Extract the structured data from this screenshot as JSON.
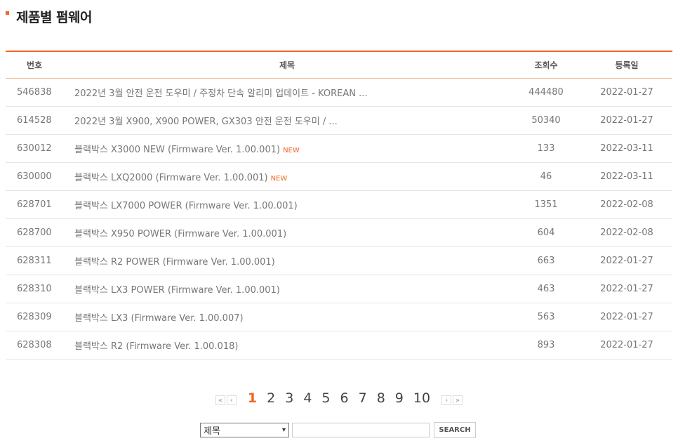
{
  "page": {
    "title": "제품별 펌웨어"
  },
  "table": {
    "headers": {
      "num": "번호",
      "title": "제목",
      "views": "조회수",
      "date": "등록일"
    },
    "new_label": "NEW",
    "rows": [
      {
        "num": "546838",
        "title": "2022년 3월 안전 운전 도우미 / 주정차 단속 알리미 업데이트 - KOREAN ...",
        "is_new": false,
        "views": "444480",
        "date": "2022-01-27"
      },
      {
        "num": "614528",
        "title": "2022년 3월 X900, X900 POWER, GX303 안전 운전 도우미 / ...",
        "is_new": false,
        "views": "50340",
        "date": "2022-01-27"
      },
      {
        "num": "630012",
        "title": "블랙박스 X3000 NEW (Firmware Ver. 1.00.001)",
        "is_new": true,
        "views": "133",
        "date": "2022-03-11"
      },
      {
        "num": "630000",
        "title": "블랙박스 LXQ2000 (Firmware Ver. 1.00.001)",
        "is_new": true,
        "views": "46",
        "date": "2022-03-11"
      },
      {
        "num": "628701",
        "title": "블랙박스 LX7000 POWER (Firmware Ver. 1.00.001)",
        "is_new": false,
        "views": "1351",
        "date": "2022-02-08"
      },
      {
        "num": "628700",
        "title": "블랙박스 X950 POWER (Firmware Ver. 1.00.001)",
        "is_new": false,
        "views": "604",
        "date": "2022-02-08"
      },
      {
        "num": "628311",
        "title": "블랙박스 R2 POWER (Firmware Ver. 1.00.001)",
        "is_new": false,
        "views": "663",
        "date": "2022-01-27"
      },
      {
        "num": "628310",
        "title": "블랙박스 LX3 POWER (Firmware Ver. 1.00.001)",
        "is_new": false,
        "views": "463",
        "date": "2022-01-27"
      },
      {
        "num": "628309",
        "title": "블랙박스 LX3 (Firmware Ver. 1.00.007)",
        "is_new": false,
        "views": "563",
        "date": "2022-01-27"
      },
      {
        "num": "628308",
        "title": "블랙박스 R2 (Firmware Ver. 1.00.018)",
        "is_new": false,
        "views": "893",
        "date": "2022-01-27"
      }
    ]
  },
  "pagination": {
    "first_icon": "«",
    "prev_icon": "‹",
    "next_icon": "›",
    "last_icon": "»",
    "current": 1,
    "pages": [
      "1",
      "2",
      "3",
      "4",
      "5",
      "6",
      "7",
      "8",
      "9",
      "10"
    ]
  },
  "search": {
    "field_selected": "제목",
    "query_value": "",
    "button_label": "SEARCH"
  },
  "colors": {
    "accent": "#f26522"
  }
}
